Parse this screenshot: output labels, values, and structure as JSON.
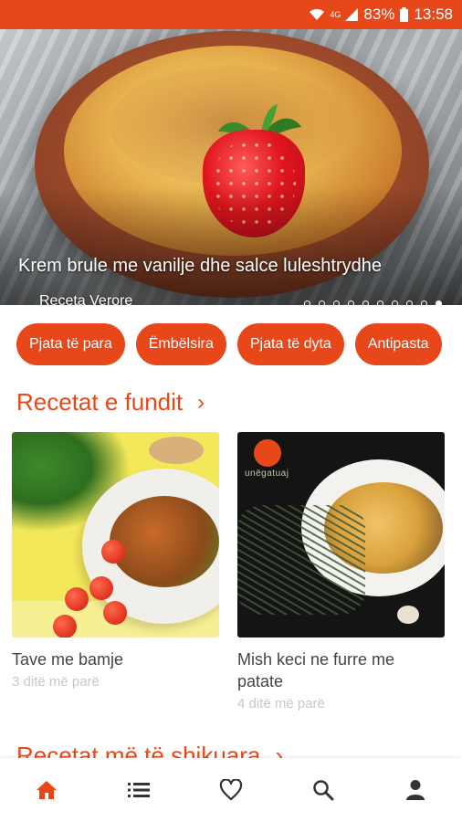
{
  "status_bar": {
    "battery": "83%",
    "time": "13:58",
    "signal_label": "4G"
  },
  "hero": {
    "title": "Krem brule me vanilje dhe salce luleshtrydhe",
    "category": "Receta Verore",
    "pager_total": 10,
    "pager_active_index": 9
  },
  "categories": [
    {
      "label": "Pjata të para"
    },
    {
      "label": "Ëmbëlsira"
    },
    {
      "label": "Pjata të dyta"
    },
    {
      "label": "Antipasta"
    }
  ],
  "latest": {
    "title": "Recetat e fundit",
    "chevron": "›",
    "recipes": [
      {
        "name": "Tave me bamje",
        "time": "3 ditë më parë"
      },
      {
        "name": "Mish keci ne furre me patate",
        "time": "4 ditë më parë"
      }
    ],
    "watermark": "unëgatuaj"
  },
  "most_viewed": {
    "title": "Recetat më të shikuara",
    "chevron": "›"
  },
  "bottom_nav": [
    {
      "icon": "home-icon",
      "active": true
    },
    {
      "icon": "list-icon",
      "active": false
    },
    {
      "icon": "heart-icon",
      "active": false
    },
    {
      "icon": "search-icon",
      "active": false
    },
    {
      "icon": "profile-icon",
      "active": false
    }
  ],
  "colors": {
    "accent": "#e8471a",
    "inactive_icon": "#333333",
    "subtle_text": "#c8c8c8"
  }
}
